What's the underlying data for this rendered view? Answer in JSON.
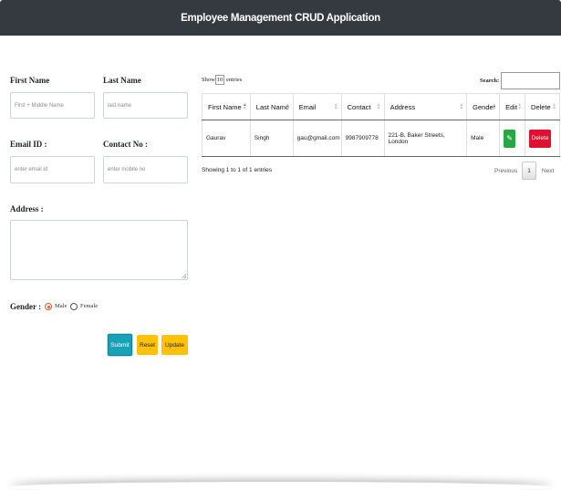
{
  "header": {
    "title": "Employee Management CRUD Application"
  },
  "form": {
    "first_name": {
      "label": "First Name",
      "placeholder": "First + Middle Name"
    },
    "last_name": {
      "label": "Last Name",
      "placeholder": "last name"
    },
    "email": {
      "label": "Email ID :",
      "placeholder": "enter email id"
    },
    "contact": {
      "label": "Contact No :",
      "placeholder": "enter mobile no"
    },
    "address": {
      "label": "Address :"
    },
    "gender": {
      "label": "Gender :",
      "options": [
        "Male",
        "Female"
      ],
      "selected": "Male"
    },
    "buttons": {
      "submit": "Submit",
      "reset": "Reset",
      "update": "Update"
    }
  },
  "table": {
    "length": {
      "prefix": "Show",
      "value": "10",
      "suffix": "entries"
    },
    "search_label": "Search:",
    "columns": [
      "First Name",
      "Last Name",
      "Email",
      "Contact",
      "Address",
      "Gender",
      "Edit",
      "Delete"
    ],
    "rows": [
      {
        "first_name": "Gaurav",
        "last_name": "Singh",
        "email": "gau@gmail.com",
        "contact": "9987909778",
        "address": "221-B, Baker Streets, London",
        "gender": "Male",
        "delete_label": "Delete"
      }
    ],
    "info": "Showing 1 to 1 of 1 entries",
    "pagination": {
      "previous": "Previous",
      "current": "1",
      "next": "Next"
    }
  },
  "colors": {
    "navbar": "#343a40",
    "submit": "#17a2b8",
    "warning": "#ffc107",
    "edit": "#28a745",
    "delete": "#e0102f"
  },
  "icons": {
    "edit": "pencil-icon"
  }
}
